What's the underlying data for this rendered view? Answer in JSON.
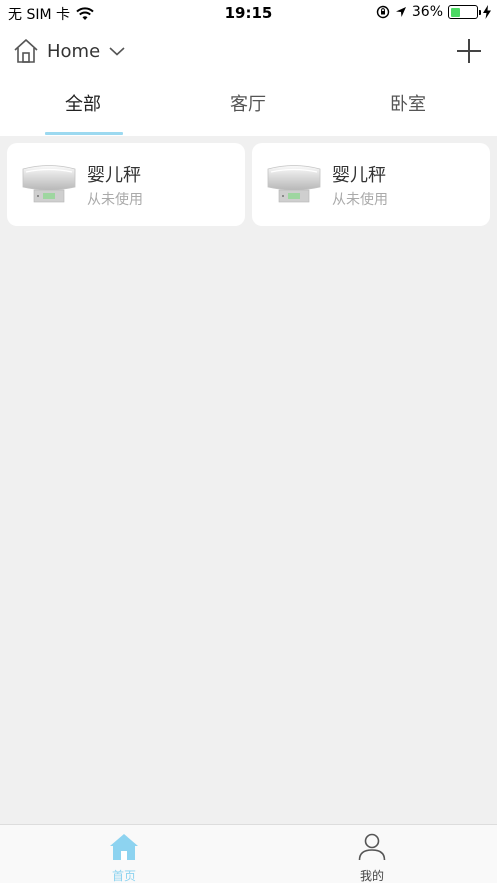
{
  "status_bar": {
    "carrier": "无 SIM 卡",
    "time": "19:15",
    "battery": "36%",
    "battery_level": 0.36
  },
  "header": {
    "home_label": "Home"
  },
  "tabs": [
    {
      "label": "全部",
      "active": true
    },
    {
      "label": "客厅",
      "active": false
    },
    {
      "label": "卧室",
      "active": false
    }
  ],
  "devices": [
    {
      "name": "婴儿秤",
      "status": "从未使用"
    },
    {
      "name": "婴儿秤",
      "status": "从未使用"
    }
  ],
  "bottom_nav": [
    {
      "label": "首页",
      "icon": "home-icon",
      "active": true
    },
    {
      "label": "我的",
      "icon": "person-icon",
      "active": false
    }
  ],
  "colors": {
    "accent": "#8dd3f0",
    "page_bg": "#f0f0f0",
    "battery_green": "#4cd964"
  }
}
